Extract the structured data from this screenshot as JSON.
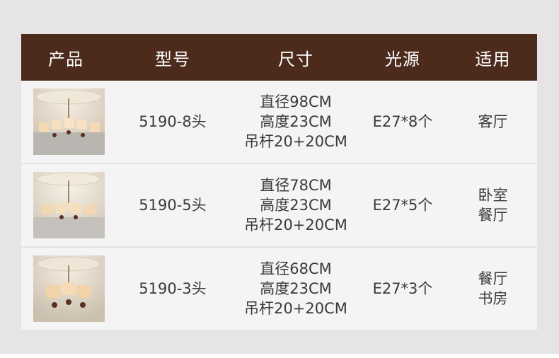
{
  "header": {
    "product": "产品",
    "model": "型号",
    "size": "尺寸",
    "light": "光源",
    "usage": "适用"
  },
  "rows": [
    {
      "image": "chandelier-8-arm-photo",
      "model": "5190-8头",
      "size": [
        "直径98CM",
        "高度23CM",
        "吊杆20+20CM"
      ],
      "light": "E27*8个",
      "usage": [
        "客厅"
      ]
    },
    {
      "image": "chandelier-5-arm-photo",
      "model": "5190-5头",
      "size": [
        "直径78CM",
        "高度23CM",
        "吊杆20+20CM"
      ],
      "light": "E27*5个",
      "usage": [
        "卧室",
        "餐厅"
      ]
    },
    {
      "image": "chandelier-3-arm-photo",
      "model": "5190-3头",
      "size": [
        "直径68CM",
        "高度23CM",
        "吊杆20+20CM"
      ],
      "light": "E27*3个",
      "usage": [
        "餐厅",
        "书房"
      ]
    }
  ],
  "colors": {
    "header_bg": "#4c2b1c",
    "row_bg": "#f4f4f4",
    "page_bg": "#e6e4e4"
  }
}
